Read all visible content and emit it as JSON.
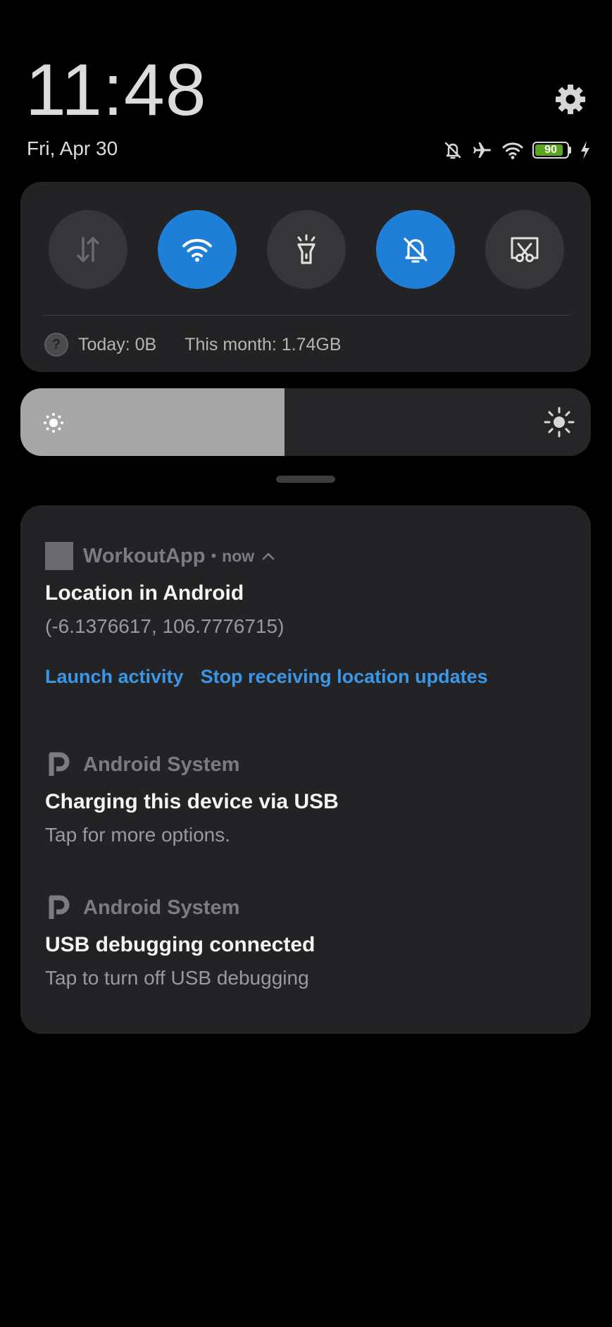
{
  "header": {
    "time": "11:48",
    "date": "Fri, Apr 30",
    "settings_icon": "gear-icon"
  },
  "status_bar": {
    "icons": [
      "bell-off-icon",
      "airplane-icon",
      "wifi-icon",
      "battery-icon",
      "charging-bolt-icon"
    ],
    "battery_level": "90",
    "battery_color": "#5aa51e"
  },
  "quick_settings": {
    "toggles": [
      {
        "name": "mobile-data",
        "icon": "data-arrows-icon",
        "state": "off"
      },
      {
        "name": "wifi",
        "icon": "wifi-icon",
        "state": "on"
      },
      {
        "name": "flashlight",
        "icon": "flashlight-icon",
        "state": "off"
      },
      {
        "name": "mute",
        "icon": "bell-off-icon",
        "state": "on"
      },
      {
        "name": "screenshot",
        "icon": "scissors-icon",
        "state": "off"
      }
    ],
    "accent_color": "#1f7fd6",
    "data_usage": {
      "help_glyph": "?",
      "today": "Today: 0B",
      "month": "This month: 1.74GB"
    }
  },
  "brightness": {
    "level": 0.463,
    "low_icon": "sun-low-icon",
    "high_icon": "sun-high-icon"
  },
  "notifications": [
    {
      "app": "WorkoutApp",
      "separator": "•",
      "time": "now",
      "title": "Location in Android",
      "body": "(-6.1376617, 106.7776715)",
      "actions": [
        "Launch activity",
        "Stop receiving location updates"
      ]
    },
    {
      "app": "Android System",
      "title": "Charging this device via USB",
      "body": "Tap for more options."
    },
    {
      "app": "Android System",
      "title": "USB debugging connected",
      "body": "Tap to turn off USB debugging"
    }
  ],
  "action_color": "#3a97e8"
}
